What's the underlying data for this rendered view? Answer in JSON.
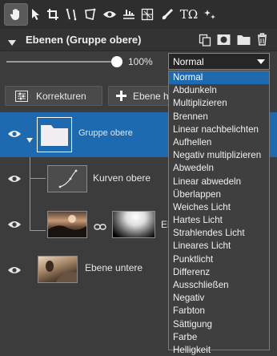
{
  "toolbar": {
    "tools": [
      "hand-icon",
      "pointer-icon",
      "crop-icon",
      "transform-icon",
      "perspective-icon",
      "eye-icon",
      "levels-icon",
      "grid-icon",
      "brush-icon",
      "text-icon",
      "effects-icon"
    ],
    "text_tool_label": "TΩ"
  },
  "panel": {
    "title": "Ebenen (Gruppe obere)"
  },
  "opacity": {
    "value_label": "100%",
    "level": 1.0
  },
  "blend": {
    "selected": "Normal",
    "options": [
      "Normal",
      "Abdunkeln",
      "Multiplizieren",
      "Brennen",
      "Linear nachbelichten",
      "Aufhellen",
      "Negativ multiplizieren",
      "Abwedeln",
      "Linear abwedeln",
      "Überlappen",
      "Weiches Licht",
      "Hartes Licht",
      "Strahlendes Licht",
      "Lineares Licht",
      "Punktlicht",
      "Differenz",
      "Ausschließen",
      "Negativ",
      "Farbton",
      "Sättigung",
      "Farbe",
      "Helligkeit"
    ]
  },
  "buttons": {
    "korrekturen": "Korrekturen",
    "ebene": "Ebene hi"
  },
  "layers": [
    {
      "name": "Gruppe obere",
      "selected": true
    },
    {
      "name": "Kurven obere",
      "selected": false
    },
    {
      "name": "Eb",
      "selected": false
    },
    {
      "name": "Ebene untere",
      "selected": false
    }
  ],
  "colors": {
    "selection": "#1e6ab1",
    "panel_bg": "#3c3c3c",
    "toolbar_bg": "#2e2e2e"
  }
}
